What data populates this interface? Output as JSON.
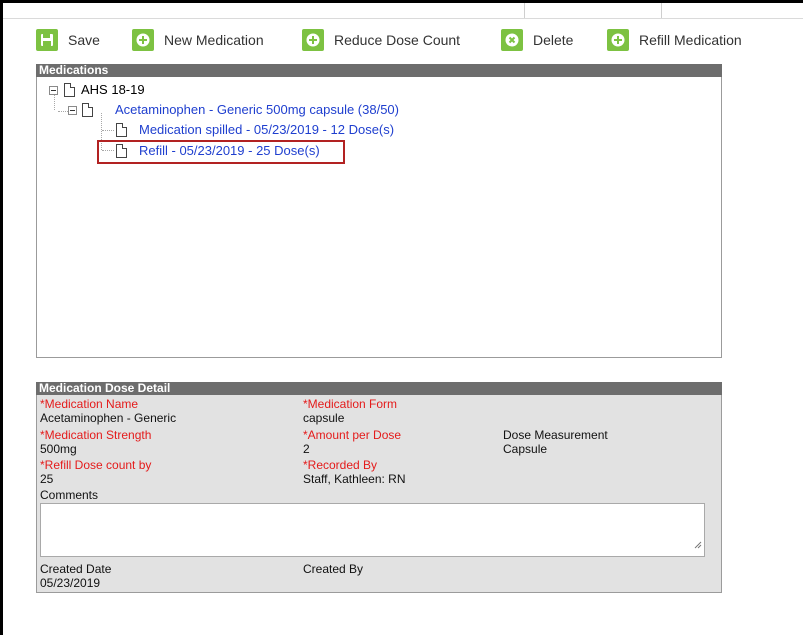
{
  "toolbar": {
    "save_label": "Save",
    "new_medication_label": "New Medication",
    "reduce_dose_label": "Reduce Dose Count",
    "delete_label": "Delete",
    "refill_label": "Refill Medication"
  },
  "medications": {
    "title": "Medications",
    "tree": {
      "root": "AHS 18-19",
      "medication": "Acetaminophen - Generic 500mg capsule (38/50)",
      "events": [
        "Medication spilled - 05/23/2019 - 12 Dose(s)",
        "Refill - 05/23/2019 - 25 Dose(s)"
      ]
    }
  },
  "detail": {
    "title": "Medication Dose Detail",
    "medication_name_label": "*Medication Name",
    "medication_name_value": "Acetaminophen - Generic",
    "medication_form_label": "*Medication Form",
    "medication_form_value": "capsule",
    "medication_strength_label": "*Medication Strength",
    "medication_strength_value": "500mg",
    "amount_per_dose_label": "*Amount per Dose",
    "amount_per_dose_value": "2",
    "dose_measurement_label": "Dose Measurement",
    "dose_measurement_value": "Capsule",
    "refill_dose_label": "*Refill Dose count by",
    "refill_dose_value": "25",
    "recorded_by_label": "*Recorded By",
    "recorded_by_value": "Staff, Kathleen: RN",
    "comments_label": "Comments",
    "comments_value": "",
    "created_date_label": "Created Date",
    "created_date_value": "05/23/2019",
    "created_by_label": "Created By",
    "created_by_value": ""
  },
  "colors": {
    "button_icon": "#7dc242",
    "header_bg": "#6d6d6d",
    "required_label": "#e41b1b",
    "tree_link": "#1f3fcf",
    "selection_outline": "#b22222"
  }
}
